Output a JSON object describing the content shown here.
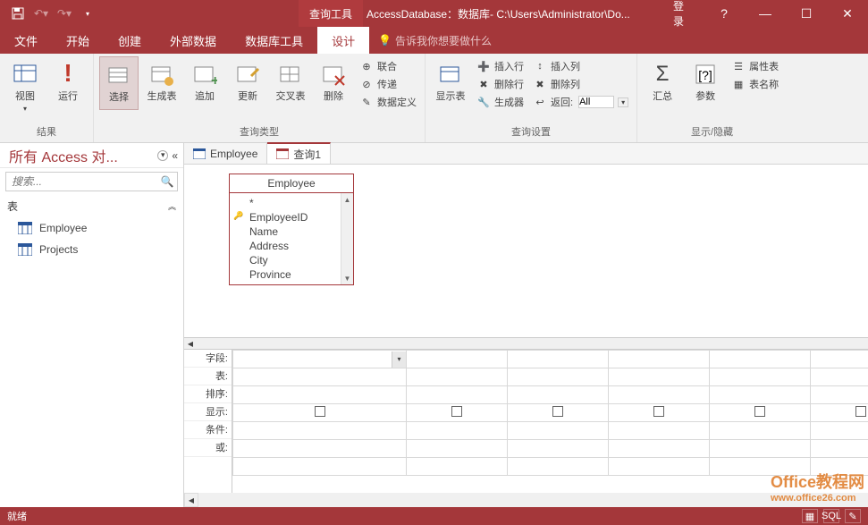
{
  "titlebar": {
    "context_tab": "查询工具",
    "title": "AccessDatabase：数据库- C:\\Users\\Administrator\\Do...",
    "login": "登录"
  },
  "tabs": {
    "file": "文件",
    "home": "开始",
    "create": "创建",
    "external": "外部数据",
    "dbtools": "数据库工具",
    "design": "设计",
    "tellme": "告诉我你想要做什么"
  },
  "ribbon": {
    "results": {
      "view": "视图",
      "run": "运行",
      "group": "结果"
    },
    "querytype": {
      "select": "选择",
      "maketable": "生成表",
      "append": "追加",
      "update": "更新",
      "crosstab": "交叉表",
      "delete": "删除",
      "union": "联合",
      "passthrough": "传递",
      "datadef": "数据定义",
      "group": "查询类型"
    },
    "querysetup": {
      "showtable": "显示表",
      "insertrows": "插入行",
      "deleterows": "删除行",
      "builder": "生成器",
      "insertcols": "插入列",
      "deletecols": "删除列",
      "return": "返回:",
      "return_val": "All",
      "group": "查询设置"
    },
    "showhide": {
      "totals": "汇总",
      "params": "参数",
      "propsheet": "属性表",
      "tablenames": "表名称",
      "group": "显示/隐藏"
    }
  },
  "nav": {
    "title": "所有 Access 对...",
    "search_placeholder": "搜索...",
    "category": "表",
    "items": [
      "Employee",
      "Projects"
    ]
  },
  "doctabs": {
    "tab1": "Employee",
    "tab2": "查询1"
  },
  "fieldlist": {
    "title": "Employee",
    "fields": [
      "*",
      "EmployeeID",
      "Name",
      "Address",
      "City",
      "Province"
    ]
  },
  "grid": {
    "labels": [
      "字段:",
      "表:",
      "排序:",
      "显示:",
      "条件:",
      "或:"
    ]
  },
  "status": {
    "ready": "就绪"
  },
  "watermark": {
    "line1": "Office教程网",
    "line2": "www.office26.com"
  }
}
